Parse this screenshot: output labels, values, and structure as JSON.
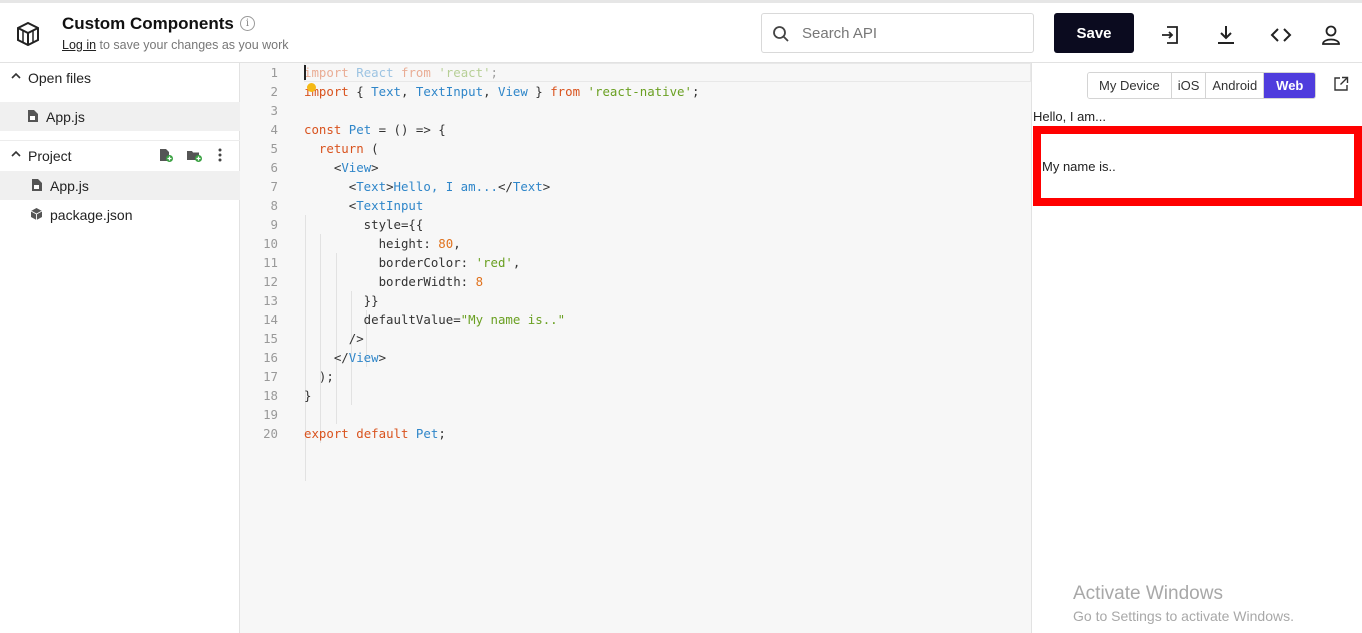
{
  "header": {
    "title": "Custom Components",
    "login_link": "Log in",
    "login_suffix": " to save your changes as you work",
    "search_placeholder": "Search API",
    "save_label": "Save",
    "icons": [
      "logo-icon",
      "info-icon",
      "search-icon",
      "import-icon",
      "download-icon",
      "code-embed-icon",
      "user-icon"
    ]
  },
  "sidebar": {
    "open_files_label": "Open files",
    "open_files": [
      {
        "label": "App.js",
        "icon": "js-file-icon"
      }
    ],
    "project_label": "Project",
    "project_files": [
      {
        "label": "App.js",
        "icon": "js-file-icon"
      },
      {
        "label": "package.json",
        "icon": "package-icon"
      }
    ]
  },
  "editor": {
    "line_numbers": [
      "1",
      "2",
      "3",
      "4",
      "5",
      "6",
      "7",
      "8",
      "9",
      "10",
      "11",
      "12",
      "13",
      "14",
      "15",
      "16",
      "17",
      "18",
      "19",
      "20"
    ]
  },
  "preview": {
    "tabs": [
      "My Device",
      "iOS",
      "Android",
      "Web"
    ],
    "active_tab": "Web",
    "text_output": "Hello, I am...",
    "input_value": "My name is..",
    "input_border_color": "red"
  },
  "watermark": {
    "title": "Activate Windows",
    "subtitle": "Go to Settings to activate Windows."
  },
  "colors": {
    "accent": "#4f3cdd",
    "save_button": "#0b0b1f",
    "keyword": "#d9531e",
    "identifier": "#2f86c9",
    "string": "#6aa022",
    "number": "#e0731f"
  }
}
